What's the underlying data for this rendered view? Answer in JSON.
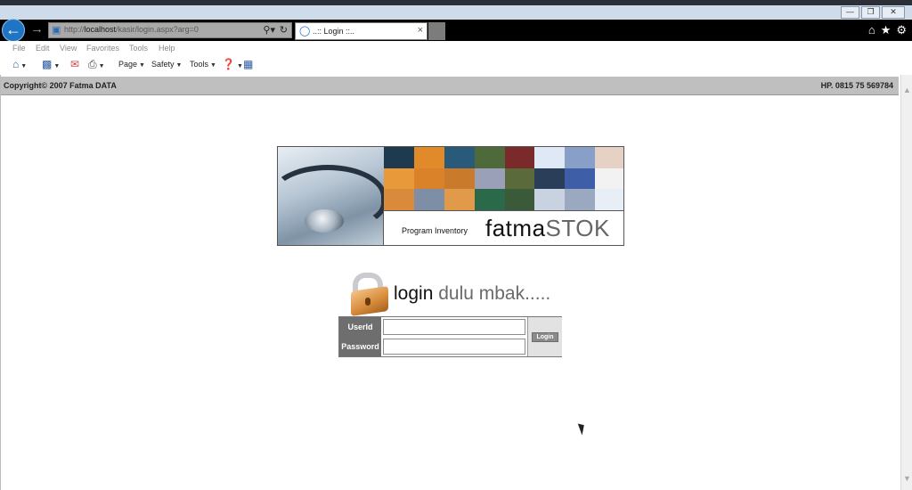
{
  "browser": {
    "address_url_prefix": "http://",
    "address_host": "localhost",
    "address_path": "/kasir/login.aspx?arg=0",
    "tab_title": "..:: Login ::..",
    "menu": [
      "File",
      "Edit",
      "View",
      "Favorites",
      "Tools",
      "Help"
    ],
    "commands": {
      "page": "Page",
      "safety": "Safety",
      "tools": "Tools"
    }
  },
  "header": {
    "copyright": "Copyright© 2007 Fatma DATA",
    "phone": "HP. 0815 75 569784"
  },
  "banner": {
    "caption": "Program Inventory",
    "brand_main": "fatma",
    "brand_accent": "STOK"
  },
  "login": {
    "heading_main": "login",
    "heading_rest": " dulu mbak.....",
    "userid_label": "UserId",
    "password_label": "Password",
    "userid_value": "",
    "password_value": "",
    "button_label": "Login"
  },
  "colors": {
    "header_bar": "#bfbfbf",
    "label_cell": "#6e6e6e",
    "button": "#8a8a8a",
    "ie_back": "#1f75c4"
  }
}
